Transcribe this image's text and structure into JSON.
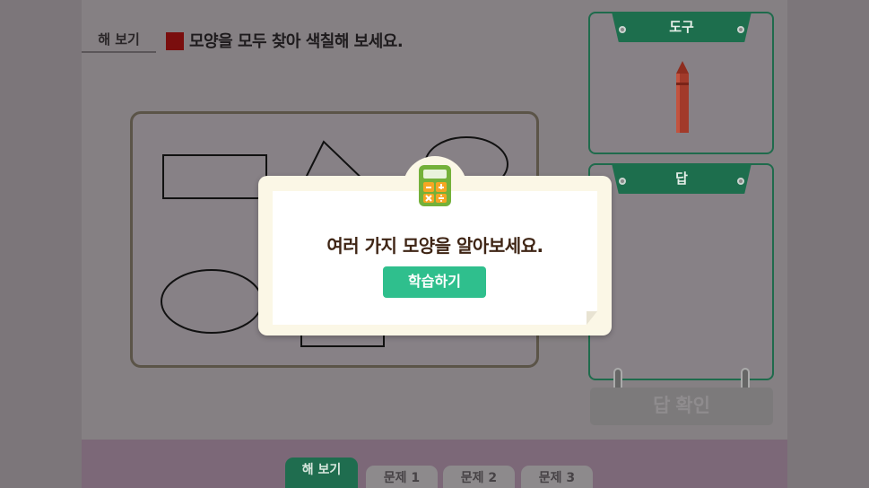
{
  "title": {
    "tag": "해 보기",
    "instruction": "모양을 모두 찾아 색칠해 보세요.",
    "target_color": "#7a0e0e"
  },
  "board": {
    "shapes": [
      "rectangle",
      "triangle",
      "circle",
      "ellipse",
      "square"
    ]
  },
  "tools_panel": {
    "label": "도구",
    "tool": "crayon",
    "tool_color": "#a23a2a"
  },
  "answer_panel": {
    "label": "답"
  },
  "confirm_button": {
    "label": "답 확인",
    "enabled": false
  },
  "footer": {
    "tabs": [
      {
        "label": "해 보기",
        "active": true
      },
      {
        "label": "문제 1",
        "active": false
      },
      {
        "label": "문제 2",
        "active": false
      },
      {
        "label": "문제 3",
        "active": false
      }
    ]
  },
  "modal": {
    "icon": "calculator-icon",
    "message": "여러 가지 모양을 알아보세요.",
    "button_label": "학습하기",
    "button_color": "#2fbf8d"
  }
}
